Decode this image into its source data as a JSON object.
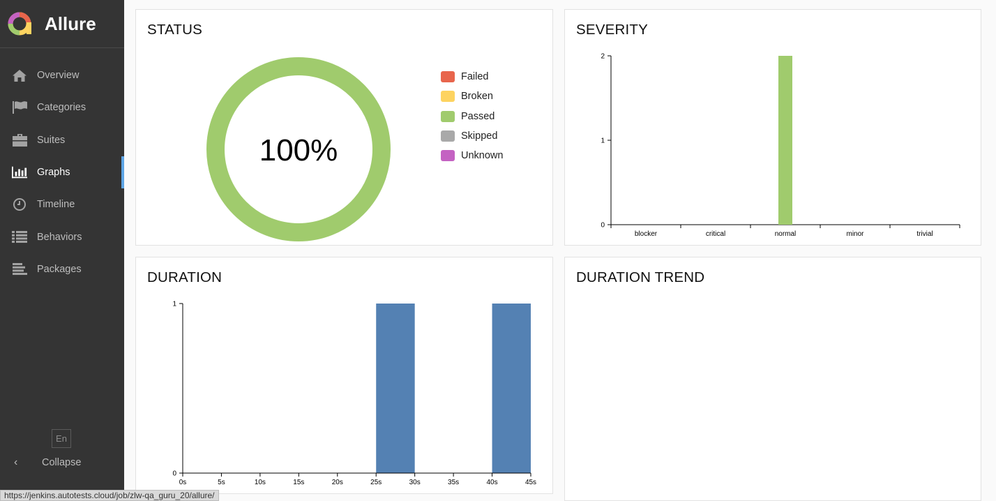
{
  "app": {
    "name": "Allure"
  },
  "sidebar": {
    "items": [
      {
        "label": "Overview",
        "icon": "home-icon"
      },
      {
        "label": "Categories",
        "icon": "flag-icon"
      },
      {
        "label": "Suites",
        "icon": "briefcase-icon"
      },
      {
        "label": "Graphs",
        "icon": "bar-chart-icon",
        "active": true
      },
      {
        "label": "Timeline",
        "icon": "clock-icon"
      },
      {
        "label": "Behaviors",
        "icon": "list-icon"
      },
      {
        "label": "Packages",
        "icon": "align-left-icon"
      }
    ],
    "language": "En",
    "collapse_label": "Collapse"
  },
  "status_bar": {
    "url": "https://jenkins.autotests.cloud/job/zlw-qa_guru_20/allure/"
  },
  "widgets": {
    "status": {
      "title": "STATUS"
    },
    "severity": {
      "title": "SEVERITY"
    },
    "duration": {
      "title": "DURATION"
    },
    "duration_trend": {
      "title": "DURATION TREND"
    }
  },
  "colors": {
    "failed": "#e8654c",
    "broken": "#fdd360",
    "passed": "#a0cb6d",
    "skipped": "#a9a9a9",
    "unknown": "#c462c2",
    "duration_bar": "#5481b3",
    "accent": "#5ea5e5"
  },
  "chart_data": [
    {
      "type": "pie",
      "title": "STATUS",
      "center_label": "100%",
      "categories": [
        "Failed",
        "Broken",
        "Passed",
        "Skipped",
        "Unknown"
      ],
      "values": [
        0,
        0,
        2,
        0,
        0
      ],
      "legend": "right"
    },
    {
      "type": "bar",
      "title": "SEVERITY",
      "categories": [
        "blocker",
        "critical",
        "normal",
        "minor",
        "trivial"
      ],
      "values": [
        0,
        0,
        2,
        0,
        0
      ],
      "yticks": [
        "0",
        "1",
        "2"
      ],
      "ylim": [
        0,
        2
      ],
      "xlabel": "",
      "ylabel": ""
    },
    {
      "type": "bar",
      "title": "DURATION",
      "xticks": [
        "0s",
        "5s",
        "10s",
        "15s",
        "20s",
        "25s",
        "30s",
        "35s",
        "40s",
        "45s"
      ],
      "bins": [
        {
          "start": 25,
          "end": 30,
          "value": 1
        },
        {
          "start": 40,
          "end": 45,
          "value": 1
        }
      ],
      "xlim": [
        0,
        45
      ],
      "yticks": [
        "0",
        "1"
      ],
      "ylim": [
        0,
        1
      ],
      "xlabel": "",
      "ylabel": ""
    }
  ]
}
